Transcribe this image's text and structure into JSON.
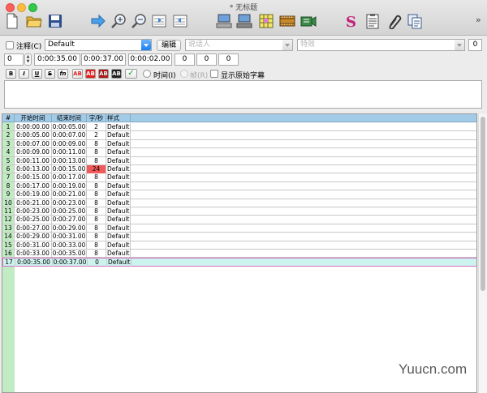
{
  "window": {
    "title": "* 无标题"
  },
  "toolbar": {
    "icons": [
      "new-file-icon",
      "open-folder-icon",
      "save-icon",
      "arrow-right-icon",
      "zoom-in-icon",
      "zoom-out-icon",
      "prev-line-icon",
      "next-line-icon",
      "add-row-icon",
      "remove-row-icon",
      "spreadsheet-icon",
      "film-timeline-icon",
      "video-clip-icon",
      "style-s-icon",
      "properties-sheet-icon",
      "attachment-icon",
      "duplicate-pages-icon"
    ],
    "more": "»"
  },
  "editor": {
    "comment_label": "注释(C)",
    "style_value": "Default",
    "edit_button": "编辑",
    "actor_placeholder": "说话人",
    "effect_placeholder": "特效",
    "effect_count": "0",
    "layer_value": "0",
    "start_time": "0:00:35.00",
    "end_time": "0:00:37.00",
    "duration": "0:00:02.00",
    "margin_l": "0",
    "margin_r": "0",
    "margin_v": "0",
    "format_buttons": [
      "B",
      "I",
      "U",
      "S",
      "fn",
      "AB",
      "AB",
      "AB",
      "AB"
    ],
    "commit_icon": "checkmark-icon",
    "time_radio": "时间(I)",
    "frame_radio": "帧(R)",
    "show_original": "显示原始字幕"
  },
  "table": {
    "headers": [
      "#",
      "开始时间",
      "结束时间",
      "字/秒",
      "样式"
    ],
    "rows": [
      [
        "1",
        "0:00:00.00",
        "0:00:05.00",
        "2",
        "Default"
      ],
      [
        "2",
        "0:00:05.00",
        "0:00:07.00",
        "2",
        "Default"
      ],
      [
        "3",
        "0:00:07.00",
        "0:00:09.00",
        "8",
        "Default"
      ],
      [
        "4",
        "0:00:09.00",
        "0:00:11.00",
        "8",
        "Default"
      ],
      [
        "5",
        "0:00:11.00",
        "0:00:13.00",
        "8",
        "Default"
      ],
      [
        "6",
        "0:00:13.00",
        "0:00:15.00",
        "24",
        "Default"
      ],
      [
        "7",
        "0:00:15.00",
        "0:00:17.00",
        "8",
        "Default"
      ],
      [
        "8",
        "0:00:17.00",
        "0:00:19.00",
        "8",
        "Default"
      ],
      [
        "9",
        "0:00:19.00",
        "0:00:21.00",
        "8",
        "Default"
      ],
      [
        "10",
        "0:00:21.00",
        "0:00:23.00",
        "8",
        "Default"
      ],
      [
        "11",
        "0:00:23.00",
        "0:00:25.00",
        "8",
        "Default"
      ],
      [
        "12",
        "0:00:25.00",
        "0:00:27.00",
        "8",
        "Default"
      ],
      [
        "13",
        "0:00:27.00",
        "0:00:29.00",
        "8",
        "Default"
      ],
      [
        "14",
        "0:00:29.00",
        "0:00:31.00",
        "8",
        "Default"
      ],
      [
        "15",
        "0:00:31.00",
        "0:00:33.00",
        "8",
        "Default"
      ],
      [
        "16",
        "0:00:33.00",
        "0:00:35.00",
        "8",
        "Default"
      ],
      [
        "17",
        "0:00:35.00",
        "0:00:37.00",
        "0",
        "Default"
      ]
    ],
    "warn_row": 5,
    "selected_row": 16
  },
  "colors": {
    "gutter": "#c1ecc3",
    "header": "#a2cbe8",
    "warn": "#f05a5a",
    "selected": "#cdf3ee"
  },
  "watermark": "Yuucn.com"
}
